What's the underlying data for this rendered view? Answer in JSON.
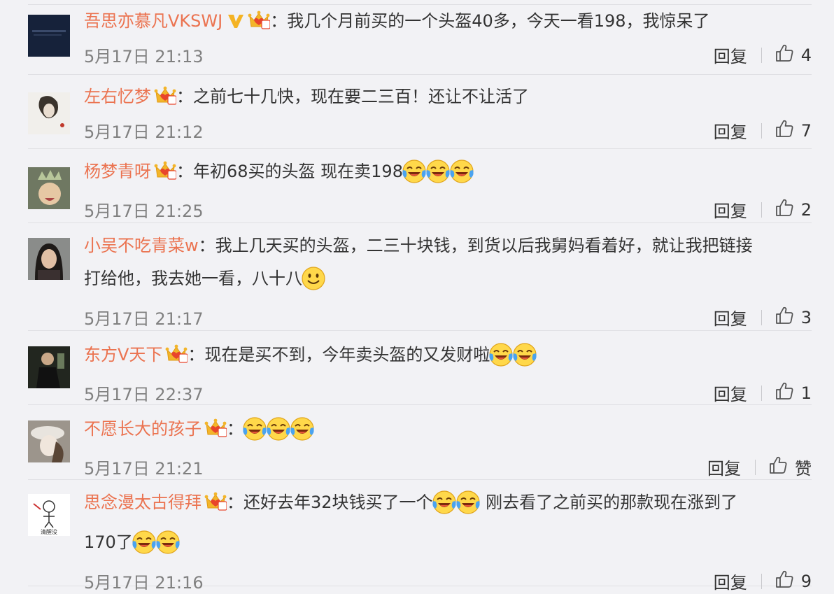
{
  "actions": {
    "reply_label": "回复",
    "zan_label": "赞"
  },
  "comments": [
    {
      "username": "吾思亦慕凡VKSWJ",
      "verified": true,
      "crown_level": "3",
      "separator": "：",
      "text_line1": "我几个月前买的一个头盔40多，今天一看198，我惊呆了",
      "emojis": [],
      "text_line2": "",
      "time": "5月17日 21:13",
      "likes": "4",
      "avatar_icon": "dark-blue-avatar"
    },
    {
      "username": "左右忆梦",
      "verified": false,
      "crown_level": "5",
      "separator": "：",
      "text_line1": "之前七十几快，现在要二三百！还让不让活了",
      "emojis": [],
      "text_line2": "",
      "time": "5月17日 21:12",
      "likes": "7",
      "avatar_icon": "sketch-woman-avatar"
    },
    {
      "username": "杨梦青呀",
      "verified": false,
      "crown_level": "2",
      "separator": "：",
      "text_line1": "年初68买的头盔  现在卖198",
      "emojis": [
        "laugh-cry-icon",
        "laugh-cry-icon",
        "laugh-cry-icon"
      ],
      "text_line2": "",
      "time": "5月17日 21:25",
      "likes": "2",
      "avatar_icon": "baby-crown-avatar"
    },
    {
      "username": "小吴不吃青菜w",
      "verified": false,
      "crown_level": "",
      "separator": "：",
      "text_line1": "我上几天买的头盔，二三十块钱，到货以后我舅妈看着好，就让我把链接",
      "emojis": [],
      "text_line2": "打给他，我去她一看，八十八",
      "emojis_line2": [
        "smile-icon"
      ],
      "time": "5月17日 21:17",
      "likes": "3",
      "avatar_icon": "woman-photo-avatar"
    },
    {
      "username": "东方V天下",
      "verified": false,
      "crown_level": "7",
      "separator": "：",
      "text_line1": "现在是买不到，今年卖头盔的又发财啦",
      "emojis": [
        "laugh-cry-icon",
        "laugh-cry-icon"
      ],
      "text_line2": "",
      "time": "5月17日 22:37",
      "likes": "1",
      "avatar_icon": "man-suit-avatar"
    },
    {
      "username": "不愿长大的孩子",
      "verified": false,
      "crown_level": "6",
      "separator": "：",
      "text_line1": "",
      "emojis": [
        "laugh-cry-icon",
        "laugh-cry-icon",
        "laugh-cry-icon"
      ],
      "text_line2": "",
      "time": "5月17日 21:21",
      "likes": "赞",
      "avatar_icon": "girl-hat-avatar"
    },
    {
      "username": "思念漫太古得拜",
      "verified": false,
      "crown_level": "2",
      "separator": "：",
      "text_line1": "还好去年32块钱买了一个",
      "emojis": [
        "laugh-cry-icon",
        "laugh-cry-icon"
      ],
      "text_line1b": " 刚去看了之前买的那款现在涨到了",
      "text_line2": "170了",
      "emojis_line2": [
        "laugh-cry-icon",
        "laugh-cry-icon"
      ],
      "time": "5月17日 21:16",
      "likes": "9",
      "avatar_icon": "cartoon-avatar",
      "avatar_caption": "清醒没"
    }
  ]
}
